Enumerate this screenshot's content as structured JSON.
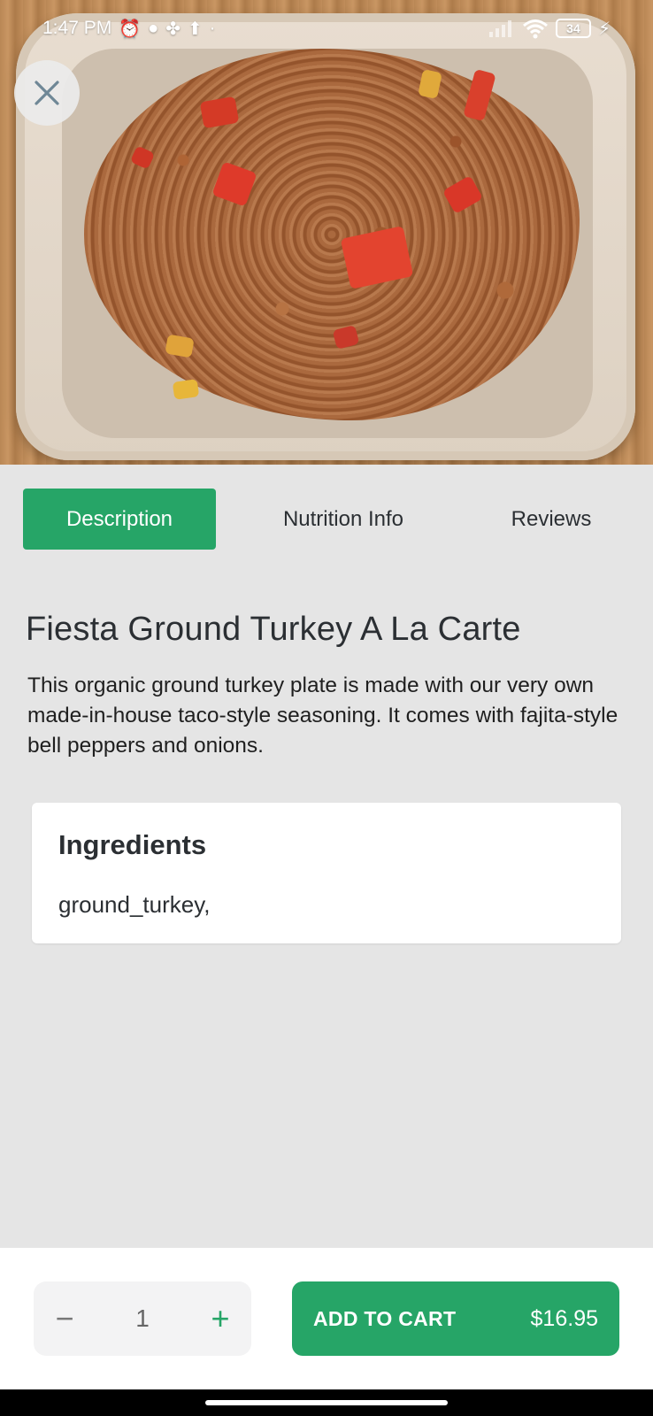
{
  "status_bar": {
    "time": "1:47 PM",
    "battery": "34"
  },
  "hero": {
    "image_description": "Photo of ground turkey with bell peppers in a takeout tray"
  },
  "tabs": [
    {
      "label": "Description",
      "active": true
    },
    {
      "label": "Nutrition Info",
      "active": false
    },
    {
      "label": "Reviews",
      "active": false
    }
  ],
  "product": {
    "title": "Fiesta Ground Turkey A La Carte",
    "description": "This organic ground turkey plate is made with our very own made-in-house taco-style seasoning.  It comes with fajita-style bell peppers and onions."
  },
  "ingredients": {
    "heading": "Ingredients",
    "text": "ground_turkey,"
  },
  "cart": {
    "quantity": "1",
    "minus": "−",
    "plus": "+",
    "button_label": "ADD TO CART",
    "price": "$16.95"
  },
  "colors": {
    "accent": "#26a567",
    "background": "#e5e5e5"
  }
}
